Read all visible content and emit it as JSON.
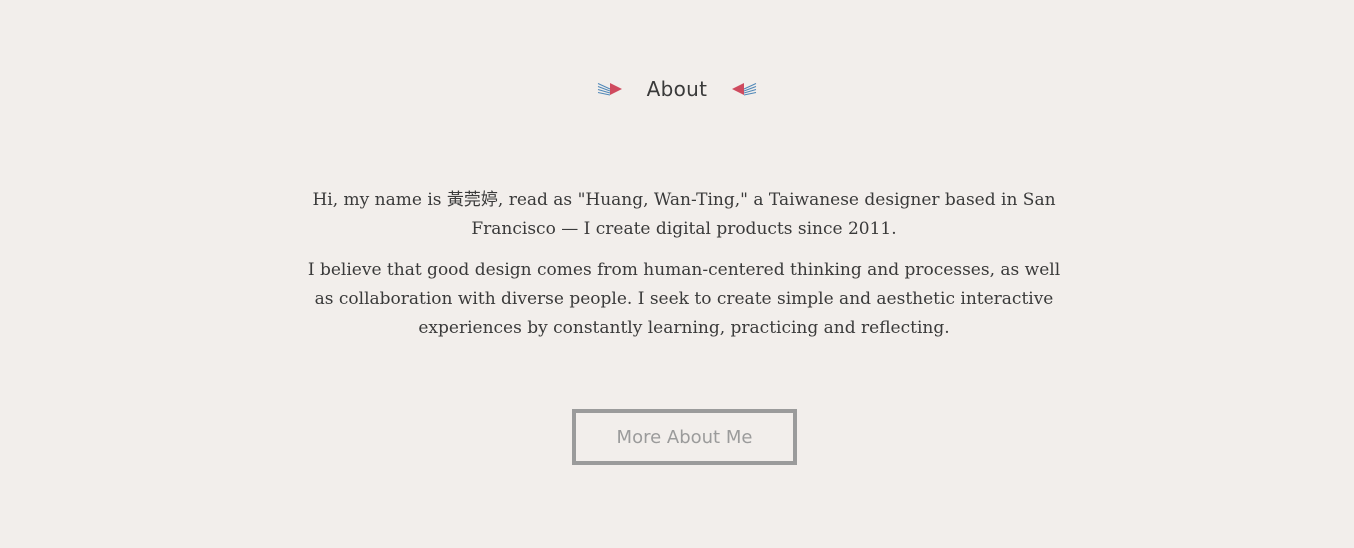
{
  "section": {
    "title": "About",
    "accent_red": "#cf4a5e",
    "accent_blue": "#4f87b8",
    "background": "#f2eeeb"
  },
  "bio": {
    "paragraph1": "Hi, my name is 黃莞婷, read as \"Huang, Wan-Ting,\" a Taiwanese designer based in San Francisco — I create digital products since 2011.",
    "paragraph2": "I believe that good design comes from human-centered thinking and processes, as well as collaboration with diverse people. I seek to create simple and aesthetic interactive experiences by constantly learning, practicing and reflecting."
  },
  "cta": {
    "label": "More About Me"
  },
  "icons": {
    "left": "arrow-right-ornament-icon",
    "right": "arrow-left-ornament-icon"
  }
}
